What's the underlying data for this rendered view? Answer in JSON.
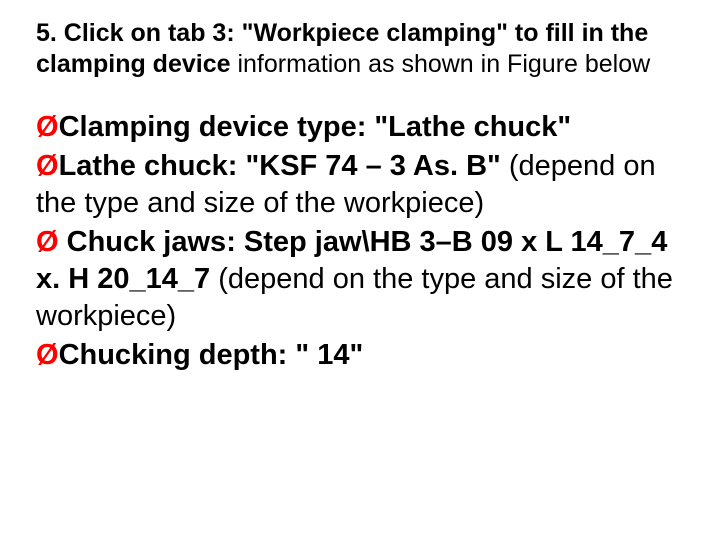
{
  "intro": {
    "lead_bold": "5. Click on tab 3: \"Workpiece clamping\" to fill in the clamping device",
    "rest": " information as shown in Figure below"
  },
  "bullets": {
    "b1": {
      "label": "Clamping device type",
      "value": ": \"Lathe chuck\""
    },
    "b2": {
      "label": "Lathe chuck",
      "value_bold": ": \"KSF 74 – 3 As. B\"",
      "value_rest": " (depend on the type and size of the workpiece)"
    },
    "b3": {
      "label": " Chuck jaws",
      "value_bold": ":  Step jaw\\HB 3–B 09 x L 14_7_4 x. H 20_14_7",
      "value_rest": " (depend on the type and size of the workpiece)"
    },
    "b4": {
      "label": "Chucking depth",
      "value": ": \" 14\""
    }
  },
  "glyphs": {
    "arrow": "Ø"
  }
}
